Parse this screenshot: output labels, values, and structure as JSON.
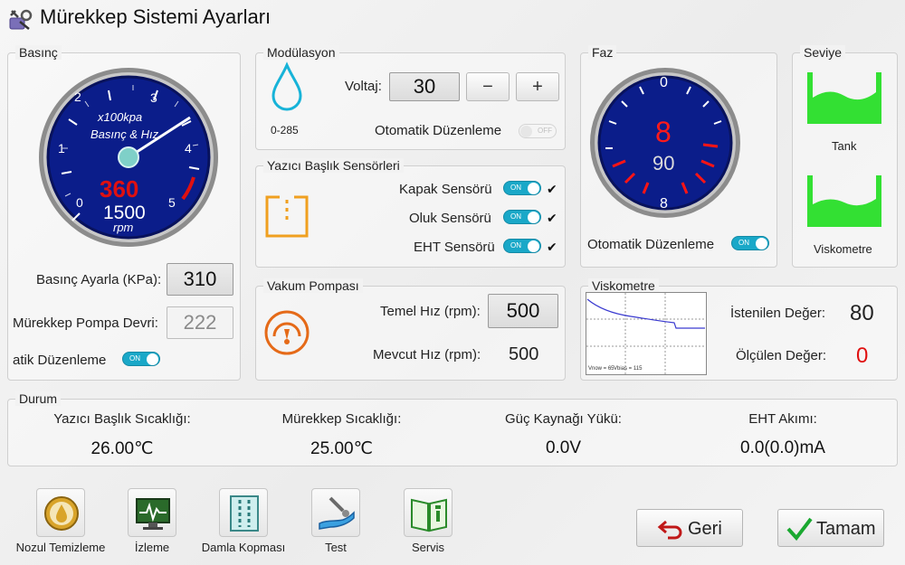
{
  "window": {
    "title": "Mürekkep Sistemi Ayarları",
    "icon": "settings-tools-icon"
  },
  "pressure": {
    "panel_title": "Basınç",
    "gauge": {
      "unit_top": "x100kpa",
      "label": "Basınç & Hız",
      "value_red": "360",
      "value_white": "1500",
      "unit_bottom": "rpm",
      "ticks": [
        "0",
        "1",
        "2",
        "3",
        "4",
        "5"
      ]
    },
    "set_label": "Basınç Ayarla (KPa):",
    "set_value": "310",
    "pump_label": "Mürekkep Pompa Devri:",
    "pump_value": "222",
    "auto_label": "atik Düzenleme",
    "auto_toggle": "ON"
  },
  "modulation": {
    "panel_title": "Modülasyon",
    "range": "0-285",
    "voltage_label": "Voltaj:",
    "voltage_value": "30",
    "minus_label": "−",
    "plus_label": "+",
    "auto_label": "Otomatik Düzenleme",
    "auto_toggle": "OFF"
  },
  "sensors": {
    "panel_title": "Yazıcı Başlık Sensörleri",
    "items": [
      {
        "label": "Kapak Sensörü",
        "toggle": "ON",
        "check": "✔"
      },
      {
        "label": "Oluk Sensörü",
        "toggle": "ON",
        "check": "✔"
      },
      {
        "label": "EHT Sensörü",
        "toggle": "ON",
        "check": "✔"
      }
    ]
  },
  "vacuum": {
    "panel_title": "Vakum Pompası",
    "base_label": "Temel Hız (rpm):",
    "base_value": "500",
    "current_label": "Mevcut Hız (rpm):",
    "current_value": "500"
  },
  "phase": {
    "panel_title": "Faz",
    "top_tick": "0",
    "bottom_tick": "8",
    "value_red": "8",
    "value_white": "90",
    "auto_label": "Otomatik Düzenleme",
    "auto_toggle": "ON"
  },
  "level": {
    "panel_title": "Seviye",
    "tank_label": "Tank",
    "visco_label": "Viskometre"
  },
  "viscometer": {
    "panel_title": "Viskometre",
    "chart_caption_left": "Vnow = 65",
    "chart_caption_right": "Vbias = 115",
    "target_label": "İstenilen Değer:",
    "target_value": "80",
    "measured_label": "Ölçülen Değer:",
    "measured_value": "0"
  },
  "status": {
    "panel_title": "Durum",
    "items": [
      {
        "label": "Yazıcı Başlık Sıcaklığı:",
        "value": "26.00℃"
      },
      {
        "label": "Mürekkep Sıcaklığı:",
        "value": "25.00℃"
      },
      {
        "label": "Güç Kaynağı Yükü:",
        "value": "0.0V"
      },
      {
        "label": "EHT Akımı:",
        "value": "0.0(0.0)mA"
      }
    ]
  },
  "toolbar": {
    "items": [
      {
        "label": "Nozul Temizleme",
        "icon": "nozzle-clean-icon"
      },
      {
        "label": "İzleme",
        "icon": "monitor-icon"
      },
      {
        "label": "Damla Kopması",
        "icon": "drop-break-icon"
      },
      {
        "label": "Test",
        "icon": "test-hand-icon"
      },
      {
        "label": "Servis",
        "icon": "service-book-icon"
      }
    ]
  },
  "actions": {
    "back_label": "Geri",
    "ok_label": "Tamam"
  },
  "colors": {
    "accent_teal": "#1aa8c8",
    "gauge_blue": "#0a1a7a",
    "alert_red": "#e01010",
    "level_green": "#33e033",
    "icon_orange": "#f0a020"
  }
}
